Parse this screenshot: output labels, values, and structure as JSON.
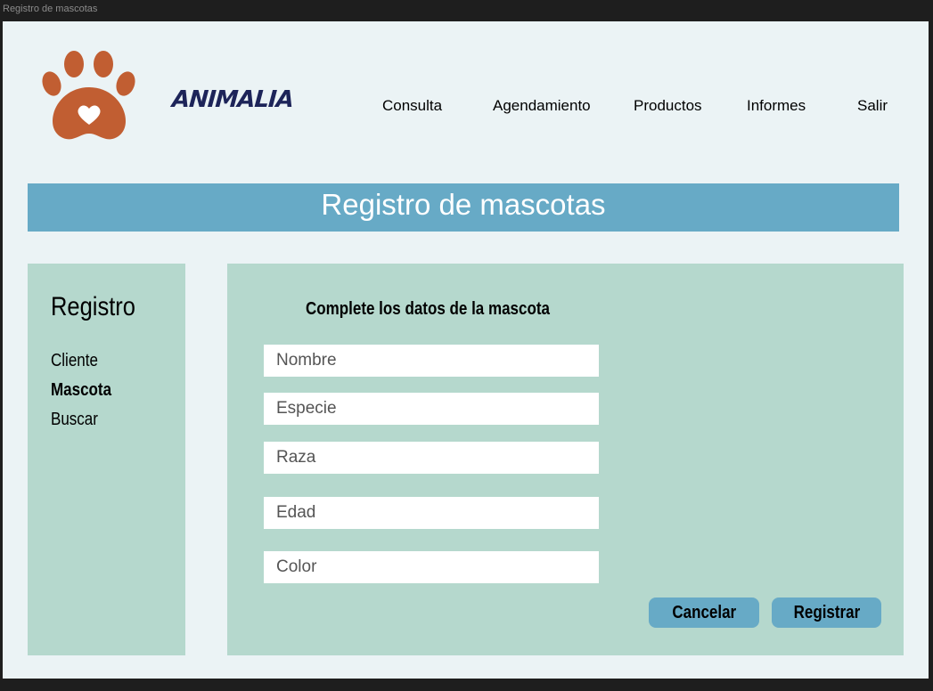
{
  "window": {
    "title": "Registro de mascotas"
  },
  "brand": {
    "name": "ANIMALIA",
    "accent": "#c15e32",
    "text_color": "#1d2459"
  },
  "nav": {
    "items": [
      {
        "label": "Consulta"
      },
      {
        "label": "Agendamiento"
      },
      {
        "label": "Productos"
      },
      {
        "label": "Informes"
      },
      {
        "label": "Salir"
      }
    ]
  },
  "banner": {
    "title": "Registro de mascotas",
    "color": "#67aac6"
  },
  "sidebar": {
    "title": "Registro",
    "items": [
      {
        "label": "Cliente"
      },
      {
        "label": "Mascota"
      },
      {
        "label": "Buscar"
      }
    ],
    "active": "Mascota",
    "color": "#b5d8cd"
  },
  "form": {
    "title": "Complete los datos de la mascota",
    "fields": [
      {
        "placeholder": "Nombre",
        "value": ""
      },
      {
        "placeholder": "Especie",
        "value": ""
      },
      {
        "placeholder": "Raza",
        "value": ""
      },
      {
        "placeholder": "Edad",
        "value": ""
      },
      {
        "placeholder": "Color",
        "value": ""
      }
    ],
    "cancel_label": "Cancelar",
    "submit_label": "Registrar"
  }
}
